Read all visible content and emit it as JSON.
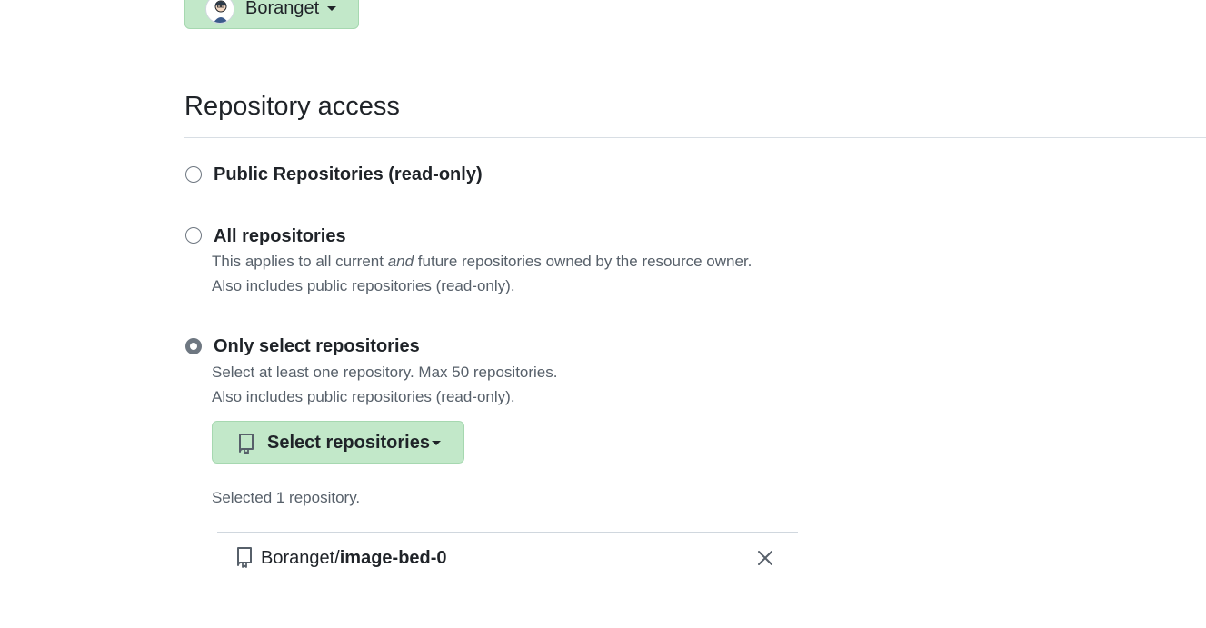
{
  "owner": {
    "name": "Boranget",
    "avatar_icon": "avatar-icon"
  },
  "section": {
    "title": "Repository access"
  },
  "options": [
    {
      "label": "Public Repositories (read-only)",
      "checked": false
    },
    {
      "label": "All repositories",
      "note_pre": "This applies to all current ",
      "note_em": "and",
      "note_post": " future repositories owned by the resource owner.",
      "note_line2": "Also includes public repositories (read-only).",
      "checked": false
    },
    {
      "label": "Only select repositories",
      "note_line1": "Select at least one repository. Max 50 repositories.",
      "note_line2": "Also includes public repositories (read-only).",
      "checked": true
    }
  ],
  "select_button": {
    "label": "Select repositories",
    "icon": "repo-icon"
  },
  "selected_summary": "Selected 1 repository.",
  "selected_repos": [
    {
      "owner": "Boranget/",
      "name": "image-bed-0",
      "icon": "repo-icon",
      "remove_icon": "close-icon"
    }
  ],
  "colors": {
    "button_green": "#c2e8c9",
    "text": "#1f2328",
    "muted": "#57606a",
    "divider": "#d8dee4"
  }
}
